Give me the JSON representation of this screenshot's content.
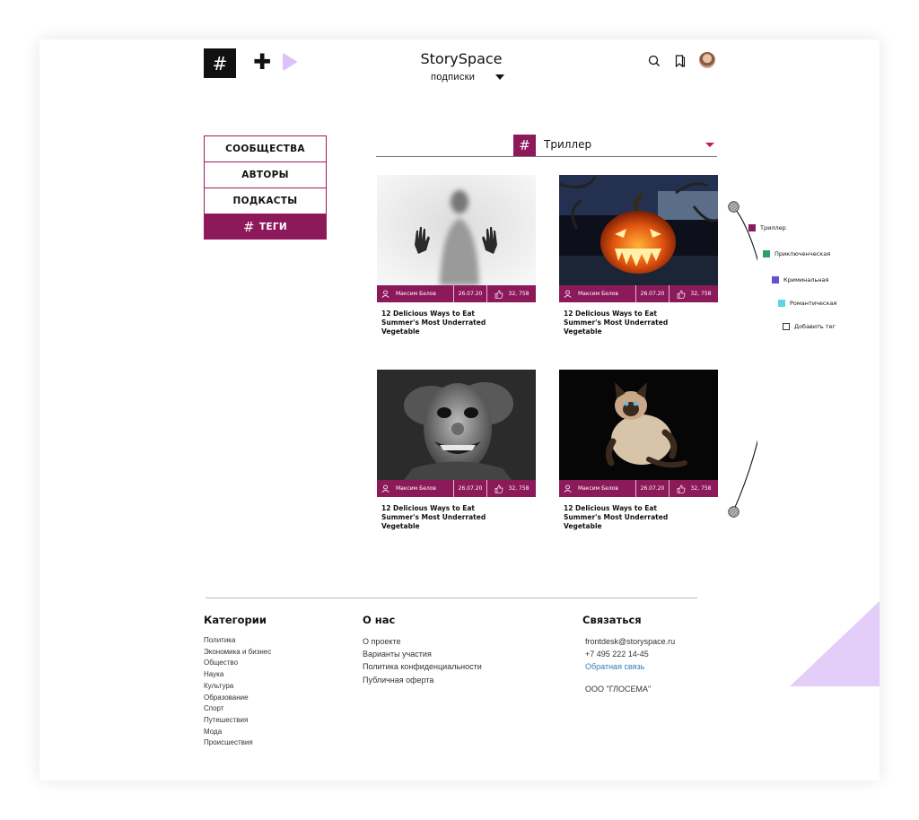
{
  "header": {
    "logo_symbol": "#",
    "brand": "StorySpace",
    "subscription_select": "подписки",
    "icons": [
      "plus-icon",
      "play-icon",
      "search-icon",
      "bookmark-icon",
      "avatar"
    ]
  },
  "sidenav": {
    "items": [
      {
        "label": "СООБЩЕСТВА"
      },
      {
        "label": "АВТОРЫ"
      },
      {
        "label": "ПОДКАСТЫ"
      },
      {
        "label": "ТЕГИ",
        "symbol": "#",
        "active": true
      }
    ]
  },
  "tag_filter": {
    "symbol": "#",
    "value": "Триллер"
  },
  "posts": [
    {
      "author": "Максим Белов",
      "date": "26.07.20",
      "likes": "32, 758",
      "title": "12 Delicious Ways to Eat Summer's Most Underrated Vegetable",
      "image": "blurred-figure-behind-glass"
    },
    {
      "author": "Максим Белов",
      "date": "26.07.20",
      "likes": "32, 758",
      "title": "12 Delicious Ways to Eat Summer's Most Underrated Vegetable",
      "image": "carved-pumpkin"
    },
    {
      "author": "Максим Белов",
      "date": "26.07.20",
      "likes": "32, 758",
      "title": "12 Delicious Ways to Eat Summer's Most Underrated Vegetable",
      "image": "creepy-clown-mask"
    },
    {
      "author": "Максим Белов",
      "date": "26.07.20",
      "likes": "32, 758",
      "title": "12 Delicious Ways to Eat Summer's Most Underrated Vegetable",
      "image": "siamese-cat-dark"
    }
  ],
  "timeline": {
    "tags": [
      {
        "label": "Триллер",
        "color": "#8c1a5a"
      },
      {
        "label": "Приключенческая",
        "color": "#2e9e6b"
      },
      {
        "label": "Криминальная",
        "color": "#6a4fd6"
      },
      {
        "label": "Романтическая",
        "color": "#5fd6e8"
      },
      {
        "label": "Добавить тег",
        "color": "#ffffff"
      }
    ]
  },
  "footer": {
    "categories": {
      "heading": "Категории",
      "links": [
        "Политика",
        "Экономика и бизнес",
        "Общество",
        "Наука",
        "Культура",
        "Образование",
        "Спорт",
        "Путешествия",
        "Мода",
        "Происшествия"
      ]
    },
    "about": {
      "heading": "О нас",
      "links": [
        "О проекте",
        "Варианты участия",
        "Политика конфиденциальности",
        "Публичная оферта"
      ]
    },
    "contact": {
      "heading": "Связаться",
      "email": "frontdesk@storyspace.ru",
      "phone": "+7 495 222 14-45",
      "feedback": "Обратная связь",
      "company": "ООО \"ГЛОСЕМА\""
    }
  },
  "colors": {
    "accent": "#8c1a5a",
    "corner": "#e2cef9",
    "play": "#d9c2f7"
  }
}
